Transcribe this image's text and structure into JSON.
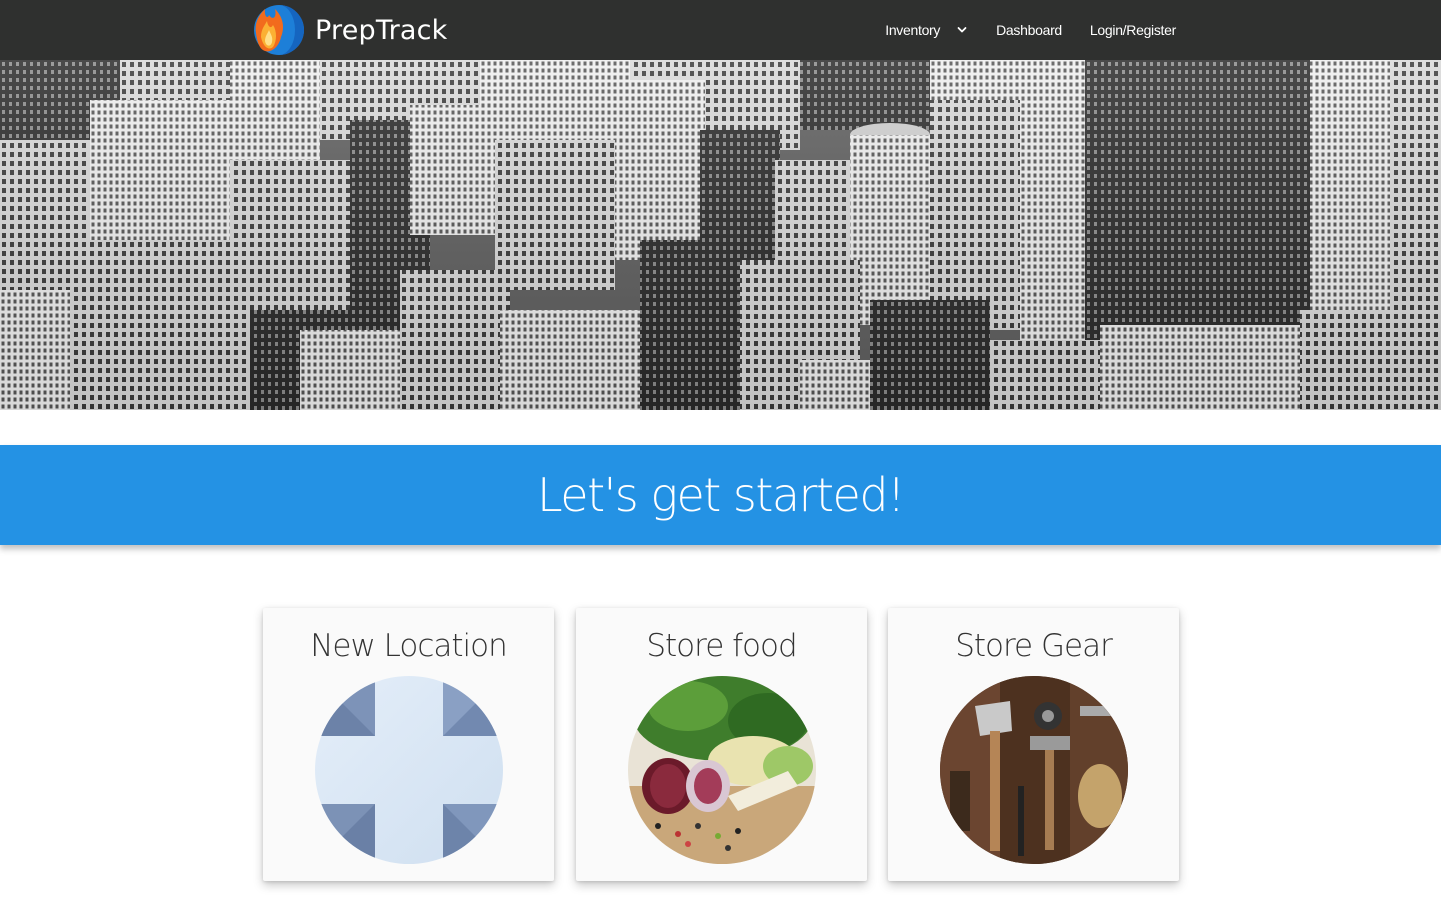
{
  "navbar": {
    "brand": "PrepTrack",
    "links": [
      {
        "label": "Inventory",
        "has_dropdown": true
      },
      {
        "label": "Dashboard"
      },
      {
        "label": "Login/Register"
      }
    ]
  },
  "banner": {
    "title": "Let's get started!"
  },
  "cards": [
    {
      "title": "New Location",
      "image": "plus-cross-image"
    },
    {
      "title": "Store food",
      "image": "vegetables-image"
    },
    {
      "title": "Store Gear",
      "image": "tools-image"
    }
  ],
  "colors": {
    "navbar_bg": "#2f302f",
    "banner_bg": "#2492e4",
    "card_bg": "#fafafa"
  }
}
